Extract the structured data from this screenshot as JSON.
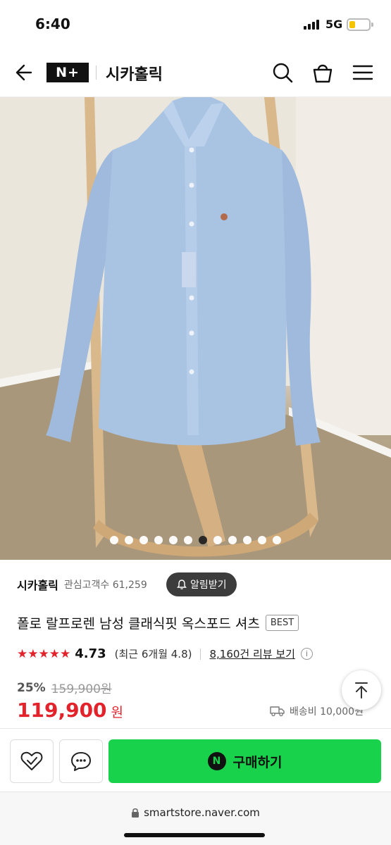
{
  "status": {
    "time": "6:40",
    "network": "5G"
  },
  "header": {
    "logo": "N+",
    "store_name": "시카홀릭"
  },
  "gallery": {
    "dot_count": 12,
    "active_index": 6
  },
  "store": {
    "name": "시카홀릭",
    "followers": "관심고객수 61,259",
    "alarm_label": "알림받기"
  },
  "product": {
    "title": "폴로 랄프로렌 남성 클래식핏 옥스포드 셔츠",
    "badge": "BEST",
    "stars": "★★★★★",
    "rating": "4.73",
    "recent_rating": "(최근 6개월 4.8)",
    "reviews_link": "8,160건 리뷰 보기",
    "discount": "25%",
    "original_price": "159,900원",
    "price": "119,900",
    "currency": "원",
    "shipping": "배송비 10,000원"
  },
  "actions": {
    "buy_label": "구매하기",
    "buy_icon": "N"
  },
  "browser": {
    "url": "smartstore.naver.com"
  }
}
